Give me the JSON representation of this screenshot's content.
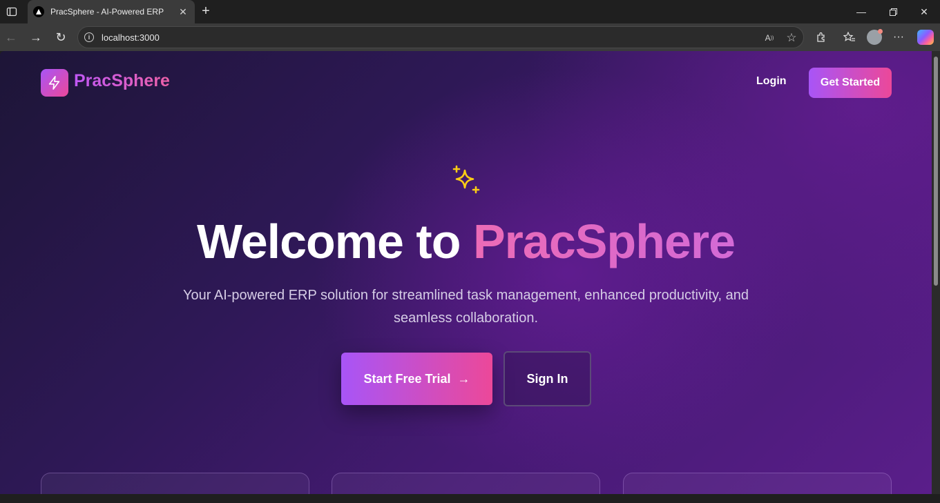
{
  "browser": {
    "tab_title": "PracSphere - AI-Powered ERP",
    "url": "localhost:3000",
    "icons": [
      "sidebar-toggle-icon",
      "close-icon",
      "plus-icon",
      "minimize-icon",
      "restore-icon",
      "window-close-icon",
      "back-icon",
      "forward-icon",
      "refresh-icon",
      "info-icon",
      "read-aloud-icon",
      "favorite-star-icon",
      "extensions-icon",
      "favorites-icon",
      "profile-icon",
      "more-icon",
      "copilot-icon"
    ]
  },
  "header": {
    "brand": "PracSphere",
    "login_label": "Login",
    "get_started_label": "Get Started"
  },
  "hero": {
    "title_prefix": "Welcome to",
    "title_accent": "PracSphere",
    "subtitle": "Your AI-powered ERP solution for streamlined task management, enhanced productivity, and seamless collaboration.",
    "primary_cta": "Start Free Trial",
    "secondary_cta": "Sign In"
  },
  "colors": {
    "accent_start": "#a855f7",
    "accent_end": "#ec4899",
    "sparkle": "#facc15",
    "background_dark": "#1d1537",
    "background_purple": "#5a1e8a"
  }
}
